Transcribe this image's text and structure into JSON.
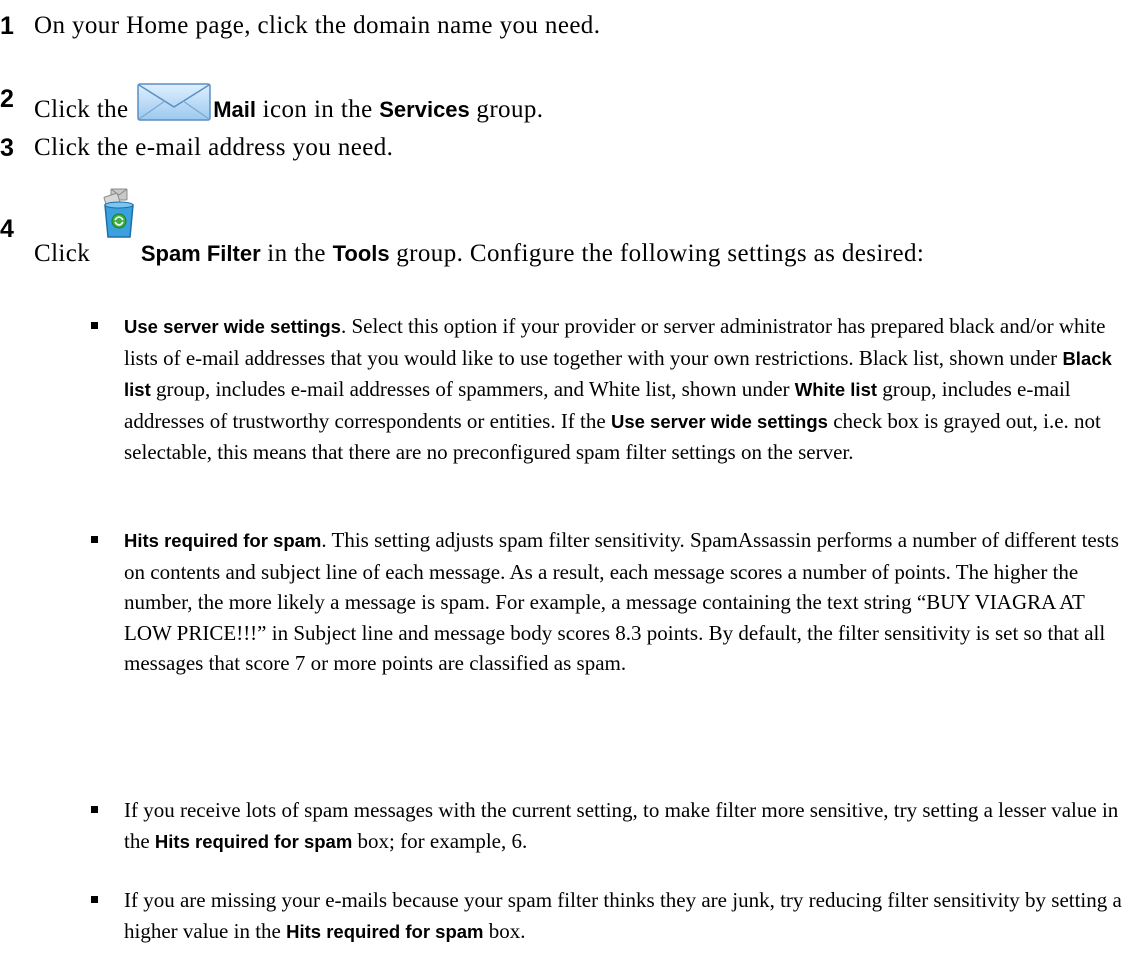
{
  "steps": [
    {
      "number": "1",
      "text": "On your Home page, click the domain name you need."
    },
    {
      "number": "2",
      "pre": "Click the ",
      "icon": "mail-envelope-icon",
      "bold1": "Mail",
      "mid": " icon in the ",
      "bold2": "Services",
      "post": " group."
    },
    {
      "number": "3",
      "text": "Click the e-mail address you need."
    },
    {
      "number": "4",
      "pre": "Click ",
      "icon": "spam-filter-bin-icon",
      "bold1": "Spam Filter",
      "mid": " in the ",
      "bold2": "Tools",
      "post": " group. Configure the following settings as desired:"
    }
  ],
  "bullets": [
    {
      "t1": "Use server wide settings",
      "t2": ". Select this option if your provider or server administrator has prepared black and/or white lists of e-mail addresses that you would like to use together with your own restrictions. Black list, shown under ",
      "t3": "Black list",
      "t4": " group, includes e-mail addresses of spammers, and White list, shown under ",
      "t5": "White list",
      "t6": " group, includes e-mail addresses of trustworthy correspondents or entities. If the ",
      "t7": "Use server wide settings",
      "t8": " check box is grayed out, i.e. not selectable, this means that there are no preconfigured spam filter settings on the server."
    },
    {
      "t1": "Hits required for spam",
      "t2": ". This setting adjusts spam filter sensitivity. SpamAssassin performs a number of different tests on contents and subject line of each message. As a result, each message scores a number of points. The higher the number, the more likely a message is spam. For example, a message containing the text string “BUY VIAGRA AT LOW PRICE!!!” in Subject line and message body scores 8.3 points. By default, the filter sensitivity is set so that all messages that score 7 or more points are classified as spam."
    },
    {
      "t1": "If you receive lots of spam messages with the current setting, to make filter more sensitive, try setting a lesser value in the ",
      "t2": "Hits required for spam",
      "t3": " box; for example, 6."
    },
    {
      "t1": "If you are missing your e-mails because your spam filter thinks they are junk, try reducing filter sensitivity by setting a higher value in the ",
      "t2": "Hits required for spam",
      "t3": " box."
    }
  ]
}
